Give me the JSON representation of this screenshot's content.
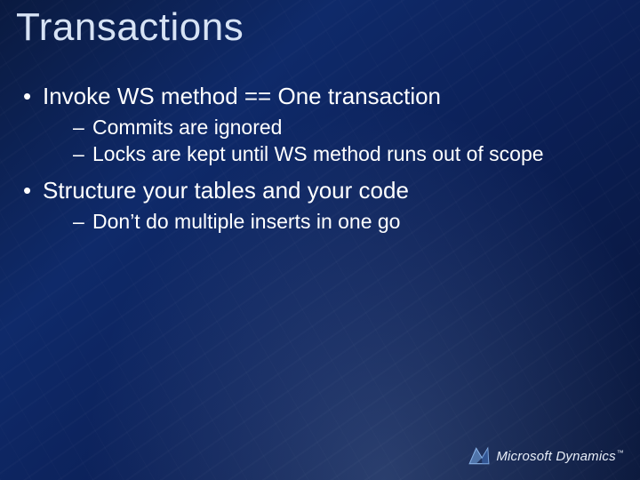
{
  "title": "Transactions",
  "bullets": [
    {
      "text": "Invoke WS method == One transaction",
      "sub": [
        "Commits are ignored",
        "Locks are kept until WS method runs out of scope"
      ]
    },
    {
      "text": "Structure your tables and your code",
      "sub": [
        "Don’t do multiple inserts in one go"
      ]
    }
  ],
  "footer": {
    "brand": "Microsoft Dynamics",
    "tm": "™"
  }
}
